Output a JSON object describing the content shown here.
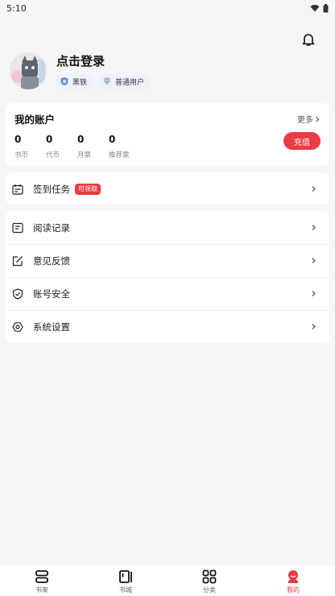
{
  "status_bar": {
    "time": "5:10"
  },
  "profile": {
    "login_text": "点击登录",
    "badges": [
      {
        "label": "黑铁",
        "icon": "shield-rank-icon"
      },
      {
        "label": "普通用户",
        "icon": "diamond-icon"
      }
    ]
  },
  "account": {
    "title": "我的账户",
    "more_label": "更多",
    "stats": [
      {
        "value": "0",
        "label": "书币"
      },
      {
        "value": "0",
        "label": "代币"
      },
      {
        "value": "0",
        "label": "月票"
      },
      {
        "value": "0",
        "label": "推荐票"
      }
    ],
    "recharge_label": "充值"
  },
  "task": {
    "label": "签到任务",
    "tag": "可领取"
  },
  "menu": [
    {
      "label": "阅读记录",
      "icon": "reading-record-icon"
    },
    {
      "label": "意见反馈",
      "icon": "feedback-icon"
    },
    {
      "label": "账号安全",
      "icon": "shield-check-icon"
    },
    {
      "label": "系统设置",
      "icon": "settings-icon"
    }
  ],
  "tabs": [
    {
      "label": "书架",
      "icon": "bookshelf-icon"
    },
    {
      "label": "书城",
      "icon": "bookstore-icon"
    },
    {
      "label": "分类",
      "icon": "category-icon"
    },
    {
      "label": "我的",
      "icon": "profile-icon"
    }
  ],
  "colors": {
    "accent": "#ea3c45",
    "background": "#f6f6f6",
    "badge_bg": "#eef2fb"
  }
}
